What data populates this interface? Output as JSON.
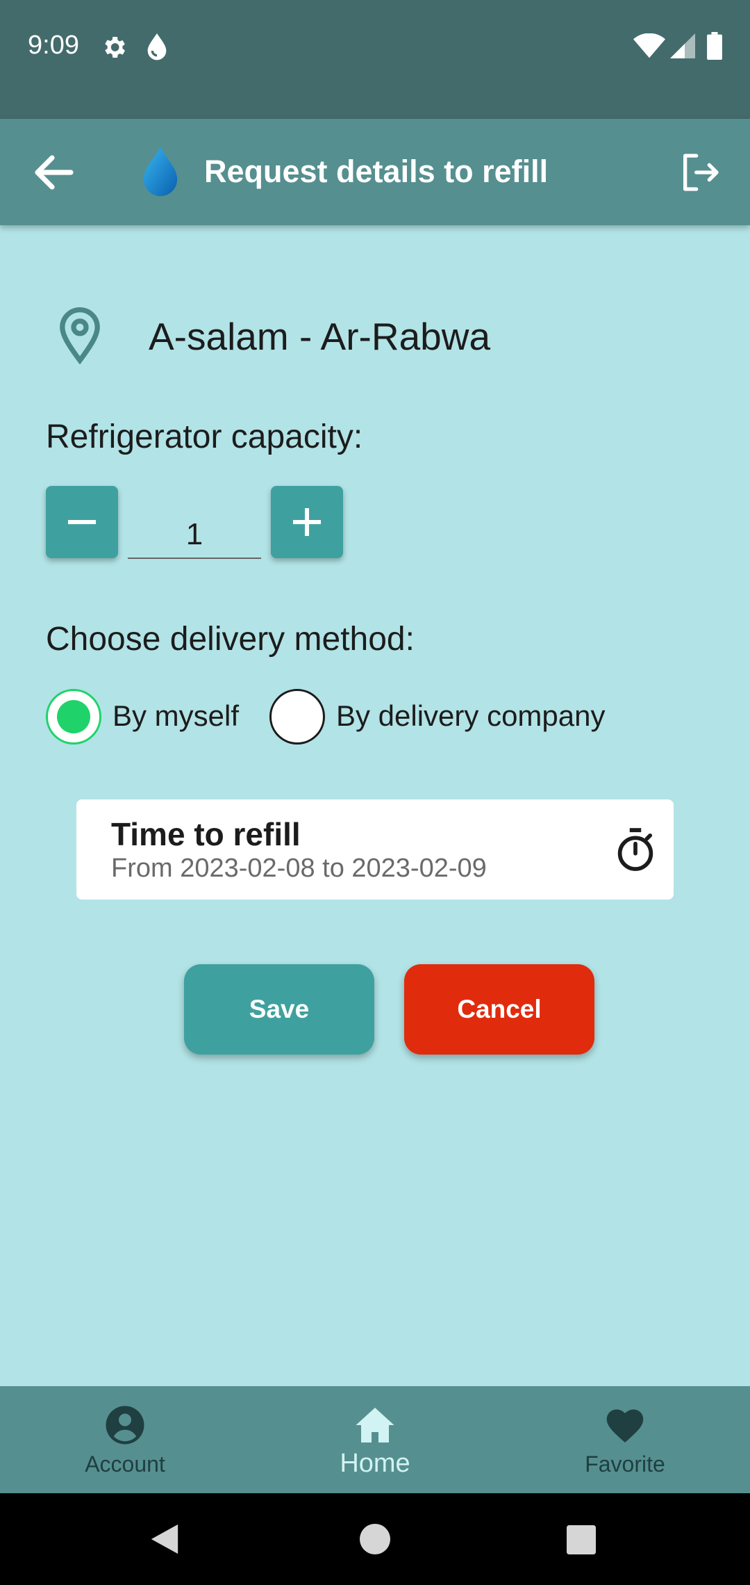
{
  "status_bar": {
    "time": "9:09",
    "icons": [
      "gear-icon",
      "water-drop-icon",
      "wifi-icon",
      "signal-icon",
      "battery-icon"
    ]
  },
  "app_bar": {
    "title": "Request details to refill",
    "back_icon": "arrow-left-icon",
    "logo_icon": "water-drop-icon",
    "logout_icon": "logout-icon"
  },
  "location": {
    "icon": "map-pin-icon",
    "text": "A-salam - Ar-Rabwa"
  },
  "capacity": {
    "label": "Refrigerator capacity:",
    "value": "1",
    "minus_icon": "minus-icon",
    "plus_icon": "plus-icon"
  },
  "delivery": {
    "label": "Choose delivery method:",
    "options": [
      {
        "label": "By myself",
        "selected": true
      },
      {
        "label": "By delivery company",
        "selected": false
      }
    ]
  },
  "refill_time": {
    "title": "Time to refill",
    "range": "From 2023-02-08 to 2023-02-09",
    "icon": "timer-icon"
  },
  "actions": {
    "save_label": "Save",
    "cancel_label": "Cancel"
  },
  "bottom_nav": {
    "items": [
      {
        "label": "Account",
        "icon": "account-icon"
      },
      {
        "label": "Home",
        "icon": "home-icon",
        "active": true
      },
      {
        "label": "Favorite",
        "icon": "heart-icon"
      }
    ]
  },
  "colors": {
    "background": "#b2e3e6",
    "status_bar": "#436b6b",
    "app_bar": "#568f90",
    "primary_button": "#3fa19f",
    "cancel_button": "#e12b0d",
    "radio_selected": "#1fd36a"
  }
}
